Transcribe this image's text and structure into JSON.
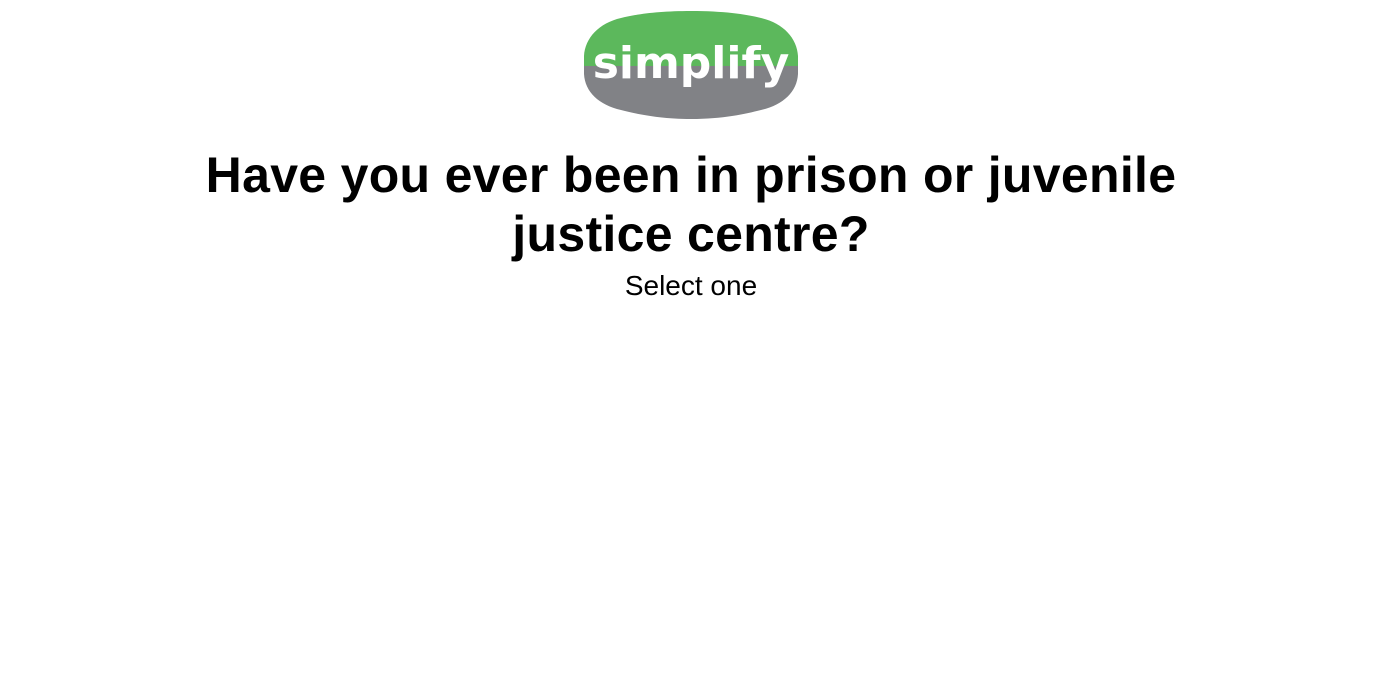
{
  "logo": {
    "text": "simplify",
    "colors": {
      "top": "#5cb85c",
      "bottom": "#818286",
      "text": "#ffffff"
    }
  },
  "question": {
    "title": "Have you ever been in prison or juvenile justice centre?",
    "instruction": "Select one"
  }
}
